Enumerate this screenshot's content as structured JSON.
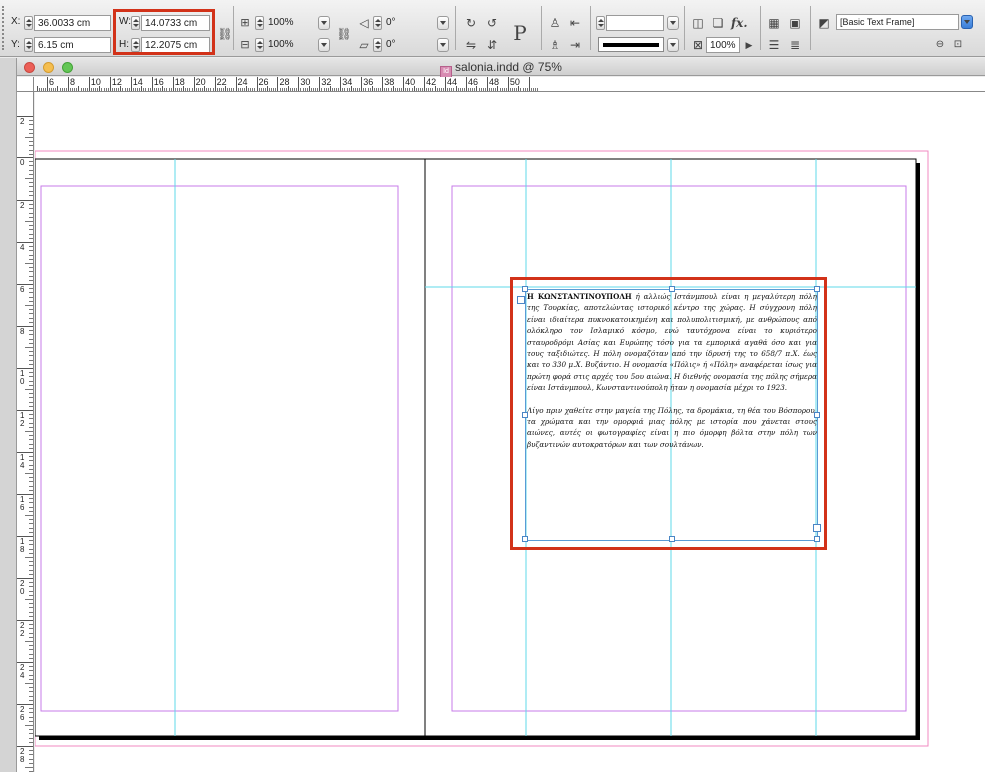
{
  "control_panel": {
    "x_label": "X:",
    "x_value": "36.0033 cm",
    "y_label": "Y:",
    "y_value": "6.15 cm",
    "w_label": "W:",
    "w_value": "14.0733 cm",
    "h_label": "H:",
    "h_value": "12.2075 cm",
    "scale_x_value": "100%",
    "scale_y_value": "100%",
    "rotate_value": "0°",
    "shear_value": "0°",
    "stroke_weight_value": "",
    "opacity_value": "100%",
    "frame_style_value": "[Basic Text Frame]",
    "fx_label": "fx."
  },
  "window": {
    "title": "salonia.indd @ 75%"
  },
  "h_ruler": {
    "labels": [
      "6",
      "8",
      "10",
      "12",
      "14",
      "16",
      "18",
      "20",
      "22",
      "24",
      "26",
      "28",
      "30",
      "32",
      "34",
      "36",
      "38",
      "40",
      "42",
      "44",
      "46",
      "48",
      "50"
    ]
  },
  "v_ruler": {
    "labels": [
      "2",
      "0",
      "2",
      "4",
      "6",
      "8",
      "1\n0",
      "1\n2",
      "1\n4",
      "1\n6",
      "1\n8",
      "2\n0",
      "2\n2",
      "2\n4",
      "2\n6",
      "2\n8"
    ]
  },
  "text_frame": {
    "para1_lead": "Η ΚΩΝΣΤΑΝΤΙΝΟΥΠΟΛΗ",
    "para1_rest": " ή αλλιώς Ιστάνμπουλ είναι η μεγαλύτερη πόλη της Τουρκίας, αποτελώντας ιστορικό κέντρο της χώρας. Η σύγχρονη πόλη είναι ιδιαίτερα πυκνοκατοικημένη και πολυπολιτισμική, με ανθρώπους από ολόκληρο τον Ισλαμικό κόσμο, ενώ ταυτόχρονα είναι το κυριότερο σταυροδρόμι Ασίας και Ευρώπης τόσο για τα εμπορικά αγαθά όσο και για τους ταξιδιώτες. Η πόλη ονομαζόταν από την ίδρυσή της το 658/7 π.Χ. έως και το 330 μ.Χ. Βυζάντιο. Η ονομασία «Πόλις» ή «Πόλη» αναφέρεται ίσως για πρώτη φορά στις αρχές του 5ου αιώνα. Η διεθνής ονομασία της πόλης σήμερα είναι Ιστάνμπουλ, Κωνσταντινούπολη ήταν η ονομασία μέχρι το 1923.",
    "para2": "Λίγο πριν χαθείτε στην μαγεία της Πόλης, τα δρομάκια, τη θέα του Βόσπορου, τα χρώματα και την ομορφιά μιας πόλης με ιστορία που χάνεται στους αιώνες, αυτές οι φωτογραφίες είναι η πιο όμορφη βόλτα στην πόλη των βυζαντινών αυτοκρατόρων και των σουλτάνων."
  },
  "colors": {
    "highlight": "#d23219",
    "bleed": "#f08ac0",
    "margin": "#c77be8",
    "guide": "#5fd8ea",
    "frame": "#5a9bd5"
  }
}
